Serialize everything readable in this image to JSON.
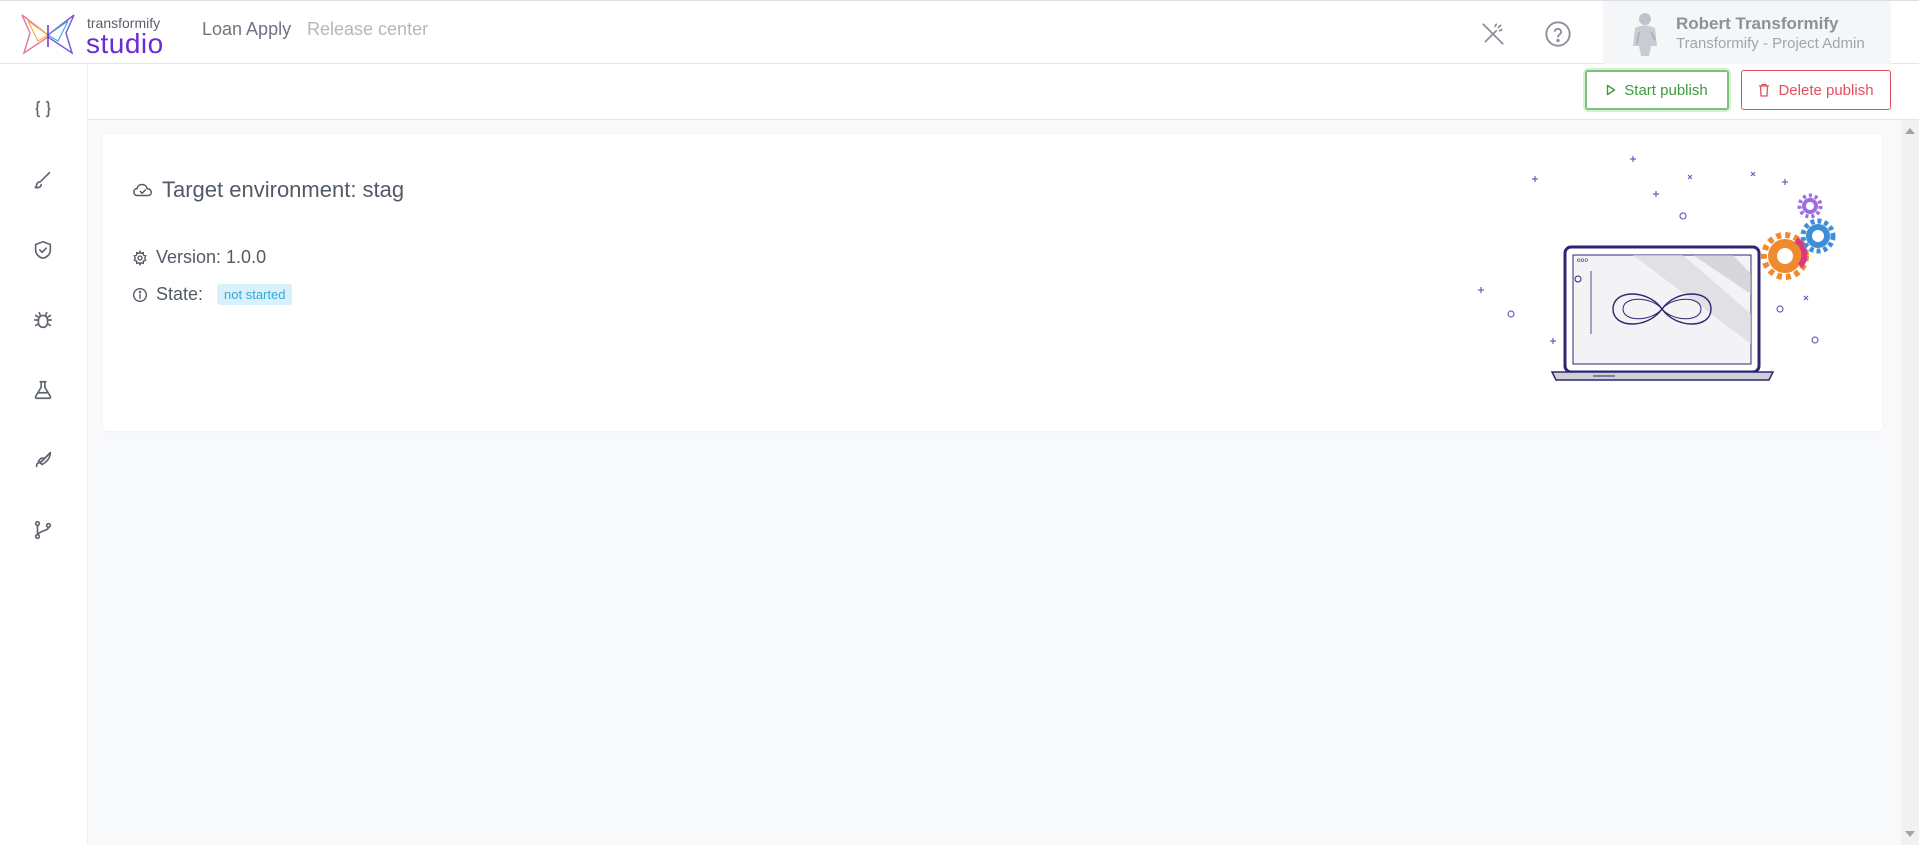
{
  "brand": {
    "small": "transformify",
    "big": "studio"
  },
  "nav": {
    "app": "Loan Apply",
    "section": "Release center"
  },
  "user": {
    "name": "Robert Transformify",
    "role": "Transformify - Project Admin"
  },
  "icons": {
    "top": [
      "magic-wand-off-icon",
      "help-circle-icon"
    ],
    "sidebar": [
      "code-braces-icon",
      "brush-icon",
      "shield-check-icon",
      "bug-icon",
      "flask-icon",
      "rocket-icon",
      "git-branch-icon"
    ]
  },
  "toolbar": {
    "start_label": "Start publish",
    "delete_label": "Delete publish"
  },
  "card": {
    "title": "Target environment: stag",
    "version_label": "Version: 1.0.0",
    "state_label": "State:",
    "state_badge": "not started"
  },
  "colors": {
    "brand": "#6c2bd9",
    "start": "#3e9a3e",
    "delete": "#e24f5c",
    "badge_bg": "#d8f1fb",
    "badge_text": "#33a9d6"
  }
}
